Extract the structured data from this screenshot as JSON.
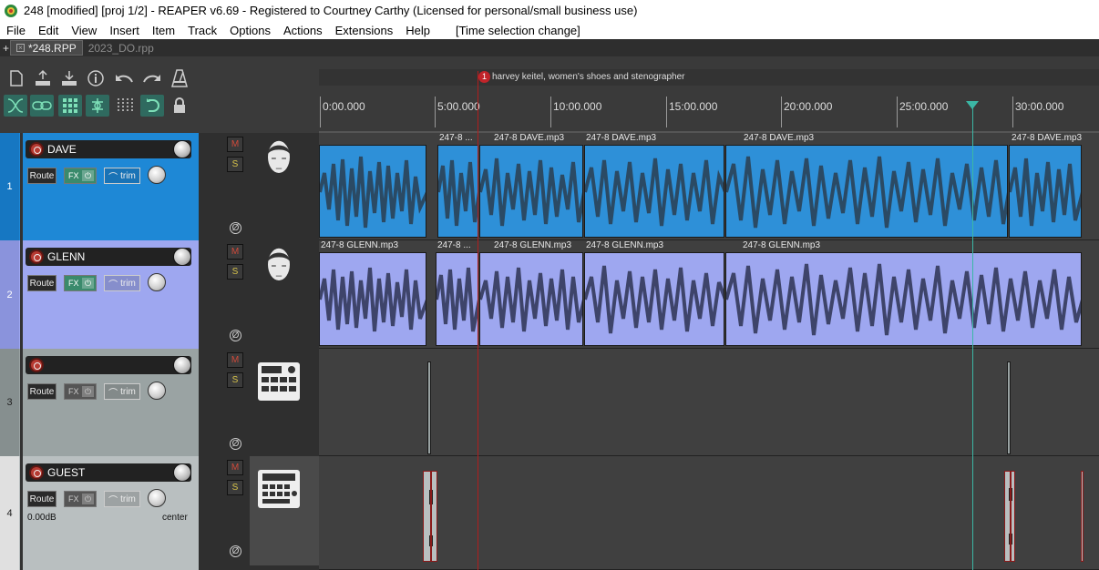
{
  "window": {
    "title": "248 [modified] [proj 1/2] - REAPER v6.69 - Registered to Courtney Carthy (Licensed for personal/small business use)"
  },
  "menu": {
    "items": [
      "File",
      "Edit",
      "View",
      "Insert",
      "Item",
      "Track",
      "Options",
      "Actions",
      "Extensions",
      "Help"
    ],
    "status": "[Time selection change]"
  },
  "tabs": [
    {
      "label": "*248.RPP",
      "active": true
    },
    {
      "label": "2023_DO.rpp",
      "active": false
    }
  ],
  "tab_add": "+",
  "toolbar": {
    "row1": [
      "new-project-icon",
      "save-project-icon",
      "open-project-icon",
      "info-icon",
      "undo-icon",
      "redo-icon",
      "metronome-icon"
    ],
    "row2": [
      "ripple-edit-icon",
      "grouping-icon",
      "snap-grid-icon",
      "link-icon",
      "grid-lines-icon",
      "loop-icon",
      "lock-icon"
    ]
  },
  "marker": {
    "number": "1",
    "label": "harvey keitel, women's shoes and stenographer",
    "color": "#c0242a"
  },
  "timeline": {
    "ticks": [
      "0:00.000",
      "5:00.000",
      "10:00.000",
      "15:00.000",
      "20:00.000",
      "25:00.000",
      "30:00.000"
    ]
  },
  "tracks": [
    {
      "number": "1",
      "name": "DAVE",
      "color": "#1e88d6",
      "route": "Route",
      "fx": "FX",
      "trim": "trim",
      "mute": "M",
      "solo": "S",
      "phase": "Ø",
      "icon": "male-face-icon",
      "items": [
        "247-8 ...",
        "247-8 DAVE.mp3",
        "247-8 DAVE.mp3",
        "247-8 DAVE.mp3",
        "247-8 DAVE.mp3"
      ]
    },
    {
      "number": "2",
      "name": "GLENN",
      "color": "#9ea7f0",
      "route": "Route",
      "fx": "FX",
      "trim": "trim",
      "mute": "M",
      "solo": "S",
      "phase": "Ø",
      "icon": "male-face-icon",
      "items": [
        "247-8 GLENN.mp3",
        "247-8 ...",
        "247-8 GLENN.mp3",
        "247-8 GLENN.mp3",
        "247-8 GLENN.mp3"
      ]
    },
    {
      "number": "3",
      "name": "",
      "color": "#9aa3a3",
      "route": "Route",
      "fx": "FX",
      "trim": "trim",
      "mute": "M",
      "solo": "S",
      "phase": "Ø",
      "icon": "drum-machine-icon",
      "items": []
    },
    {
      "number": "4",
      "name": "GUEST",
      "color": "#b9bfc0",
      "route": "Route",
      "fx": "FX",
      "trim": "trim",
      "mute": "M",
      "solo": "S",
      "phase": "Ø",
      "icon": "sampler-icon",
      "volume": "0.00dB",
      "pan": "center",
      "items": []
    }
  ]
}
